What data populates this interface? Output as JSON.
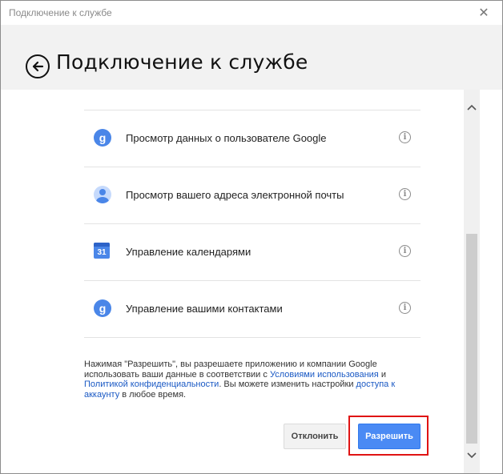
{
  "window": {
    "title": "Подключение к службе",
    "close_symbol": "✕"
  },
  "header": {
    "back_icon": "back-arrow-icon",
    "heading": "Подключение к службе"
  },
  "permissions": [
    {
      "icon": "google-g-icon",
      "icon_text": "g",
      "label": "Просмотр данных о пользователе Google"
    },
    {
      "icon": "user-avatar-icon",
      "label": "Просмотр вашего адреса электронной почты"
    },
    {
      "icon": "calendar-icon",
      "icon_text": "31",
      "label": "Управление календарями"
    },
    {
      "icon": "google-g-icon",
      "icon_text": "g",
      "label": "Управление вашими контактами"
    }
  ],
  "info_symbol": "i",
  "consent": {
    "part1": "Нажимая \"Разрешить\", вы разрешаете приложению и компании Google использовать ваши данные в соответствии с ",
    "terms_link": "Условиями использования",
    "part2": " и ",
    "privacy_link": "Политикой конфиденциальности",
    "part3": ". Вы можете изменить настройки ",
    "access_link": "доступа к аккаунту",
    "part4": " в любое время."
  },
  "buttons": {
    "decline": "Отклонить",
    "allow": "Разрешить"
  },
  "colors": {
    "accent": "#4a8af4",
    "highlight": "#e01313",
    "link": "#1a59c4"
  }
}
